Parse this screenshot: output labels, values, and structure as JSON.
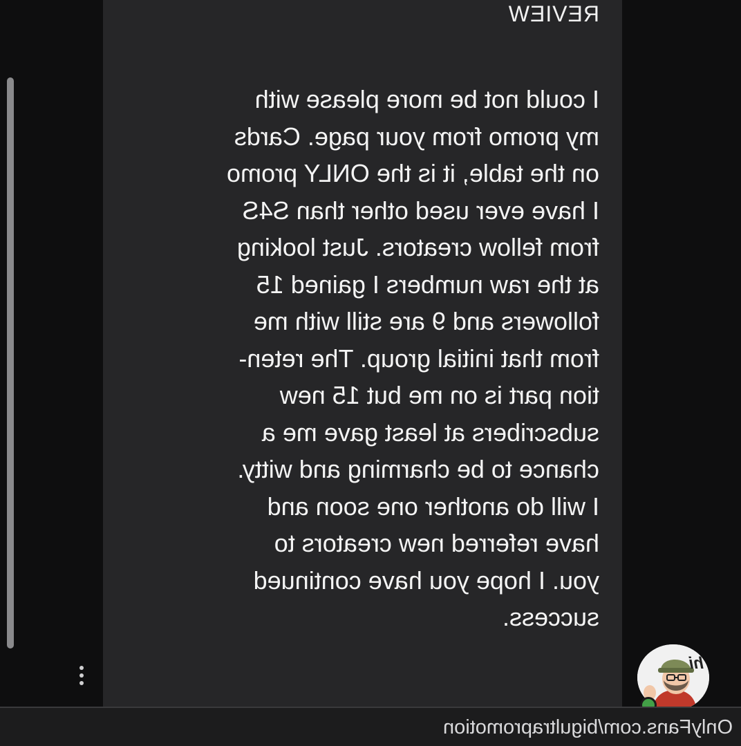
{
  "review": {
    "title": "REVIEW",
    "lines": [
      "I could not be more please with",
      "my promo from your page. Cards",
      "on the table, it is the ONLY promo",
      "I have ever used other than S4S",
      "from fellow creators. Just looking",
      "at the raw numbers I gained 15",
      "followers and 9 are still with me",
      "from that initial group. The reten-",
      "tion part is on me but 15 new",
      "subscribers at least gave me a",
      "chance to be charming and witty.",
      "I will do another one soon and",
      "have referred new creators to",
      "you. I hope you have continued",
      "success."
    ]
  },
  "avatar": {
    "caption": "hi",
    "online": true,
    "status_color": "#43a047"
  },
  "footer": {
    "link_text": "OnlyFans.com/bigultrapromotion"
  },
  "controls": {
    "more_icon": "kebab-vertical-icon"
  },
  "colors": {
    "background": "#0e0e0f",
    "bubble": "#262628",
    "text": "#f4f4f4",
    "footer": "#1c1c1d"
  }
}
